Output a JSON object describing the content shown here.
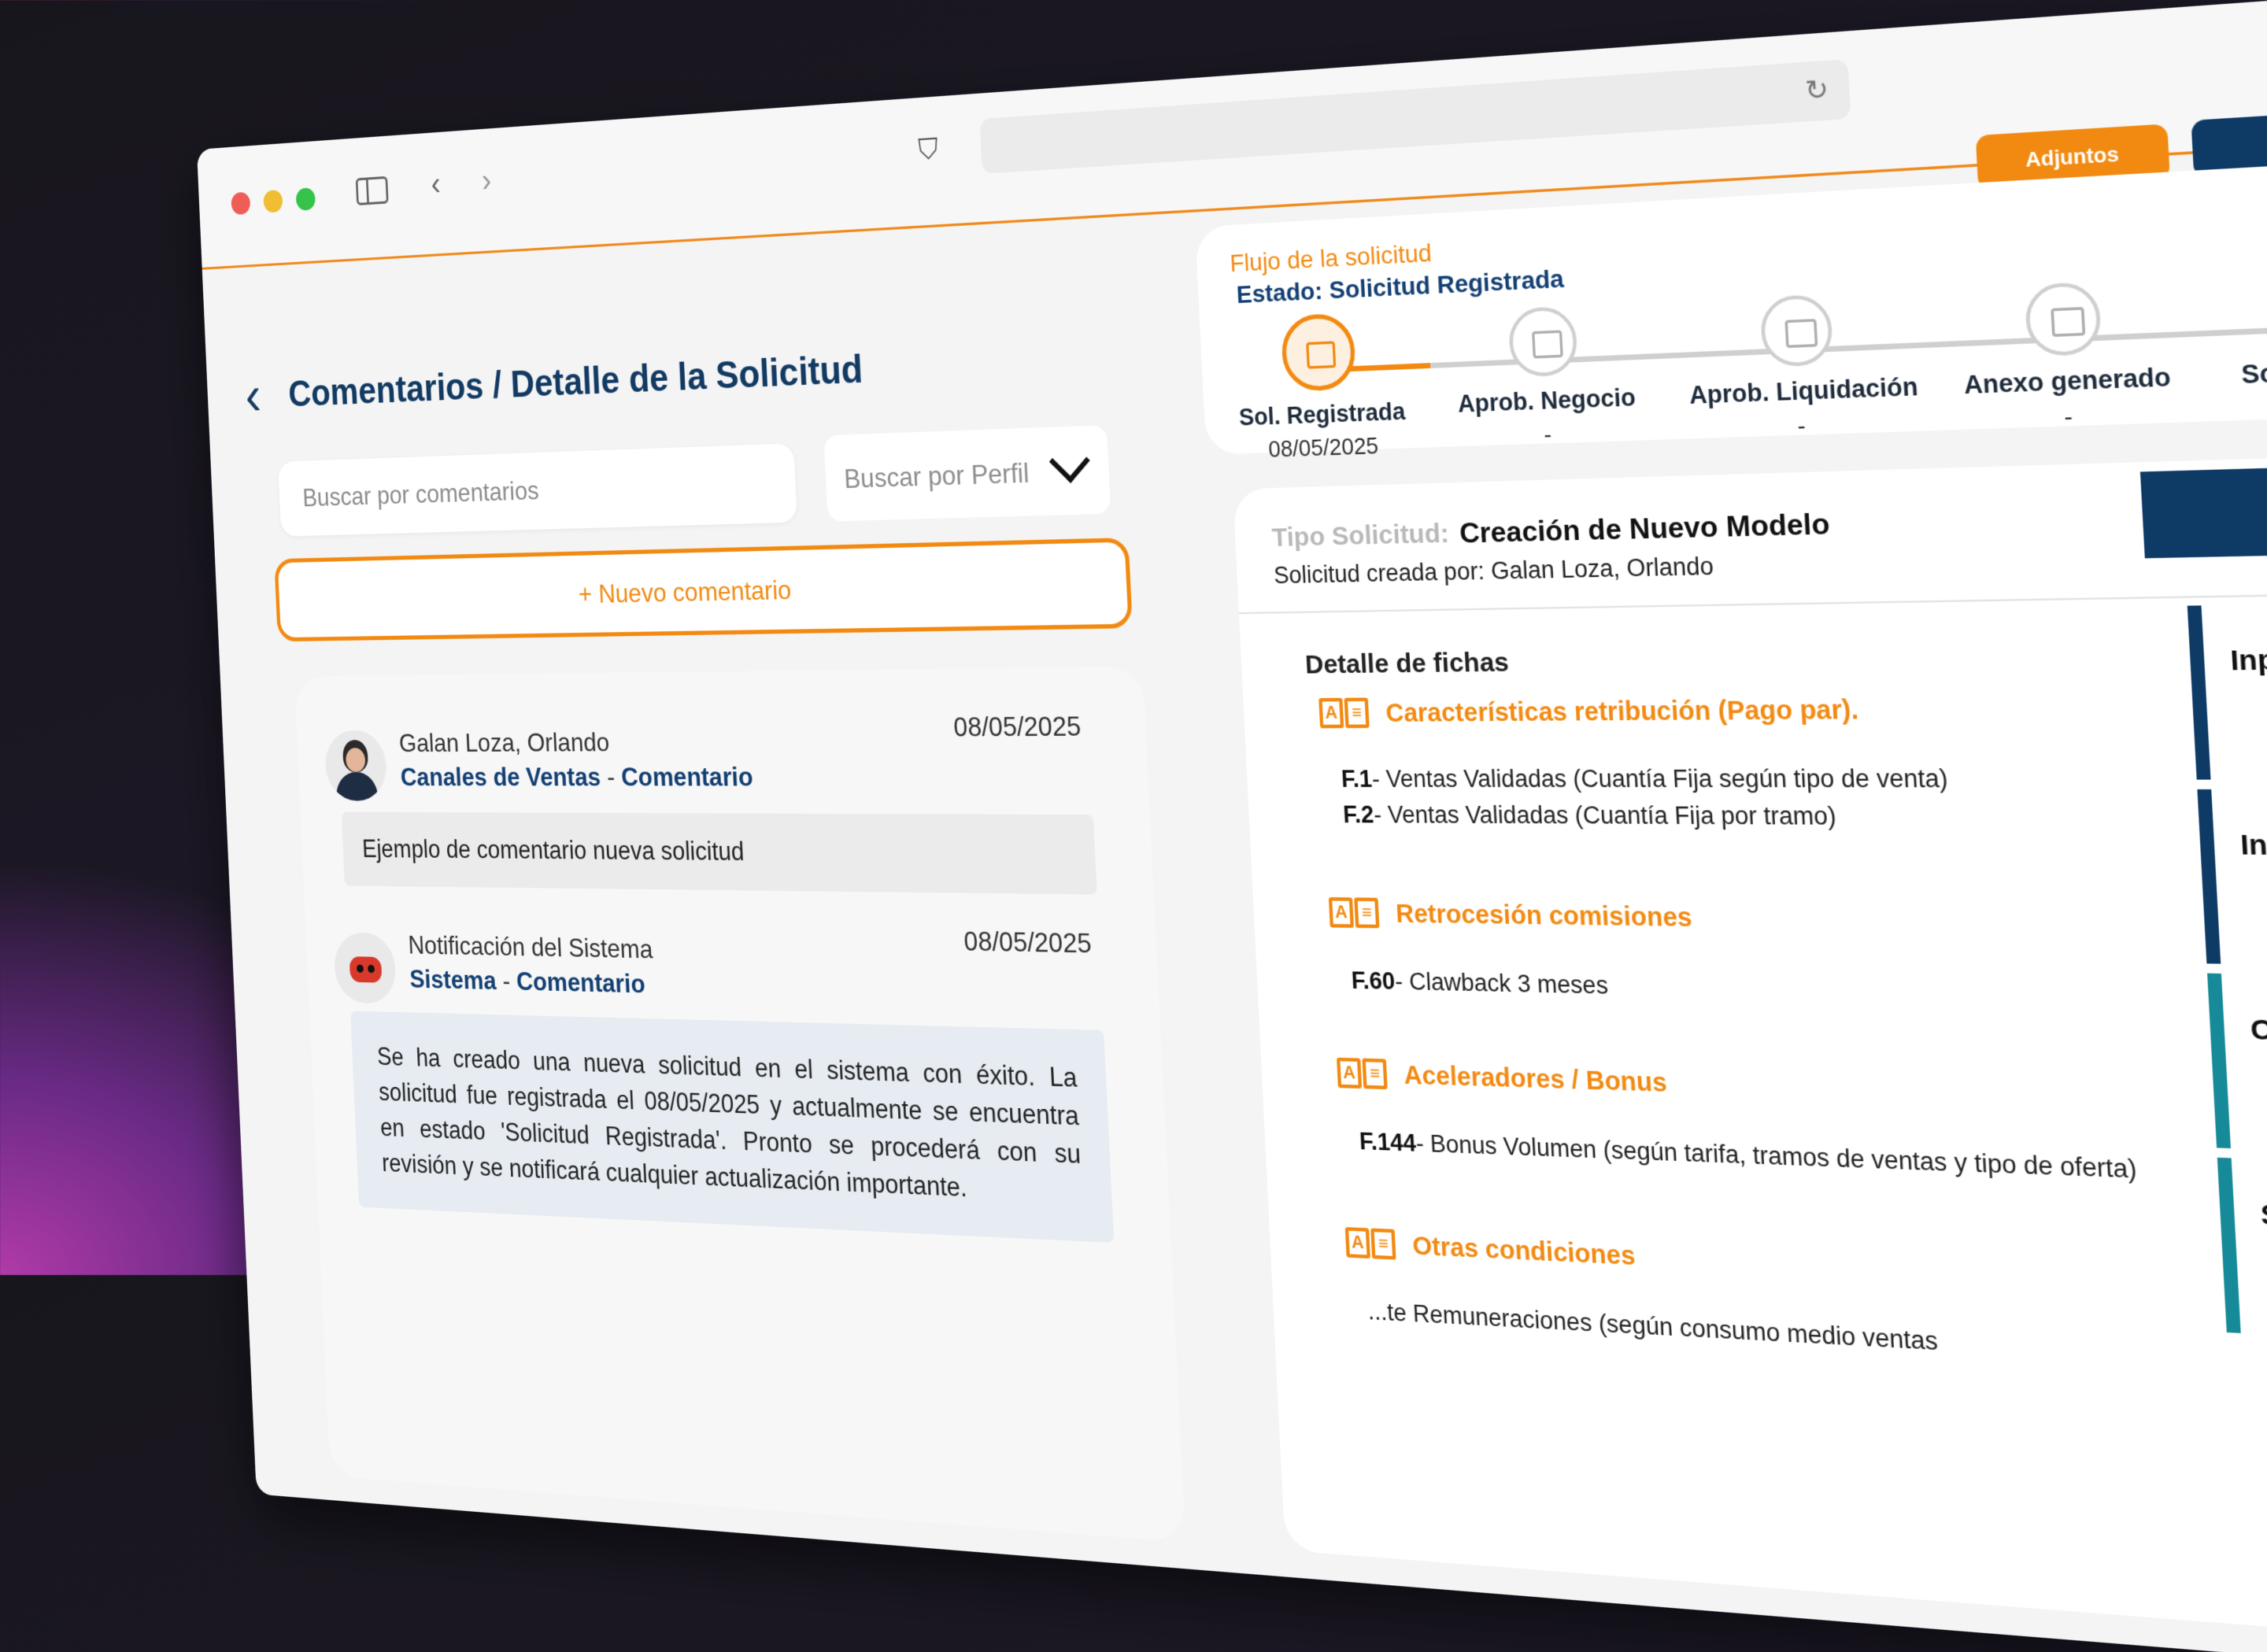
{
  "browser": {
    "buttons": {
      "adjuntos": "Adjuntos"
    }
  },
  "left": {
    "title": "Comentarios / Detalle de la Solicitud",
    "search_placeholder": "Buscar por comentarios",
    "profile_placeholder": "Buscar por Perfil",
    "new_comment": "+ Nuevo comentario",
    "comments": [
      {
        "author": "Galan Loza, Orlando",
        "channel": "Canales de Ventas",
        "sep": " - ",
        "type": "Comentario",
        "date": "08/05/2025",
        "body": "Ejemplo de comentario nueva solicitud"
      },
      {
        "author": "Notificación del Sistema",
        "channel": "Sistema",
        "sep": " - ",
        "type": "Comentario",
        "date": "08/05/2025",
        "body": "Se ha creado una nueva solicitud en el sistema con éxito. La solicitud fue registrada el 08/05/2025 y actualmente se encuentra en estado 'Solicitud Registrada'. Pronto se procederá con su revisión y se notificará cualquier actualización importante."
      }
    ]
  },
  "flow": {
    "title": "Flujo de la solicitud",
    "state": "Estado: Solicitud Registrada",
    "steps": [
      {
        "label": "Sol. Registrada",
        "date": "08/05/2025",
        "active": true
      },
      {
        "label": "Aprob. Negocio",
        "date": "-"
      },
      {
        "label": "Aprob. Liquidación",
        "date": "-"
      },
      {
        "label": "Anexo generado",
        "date": "-"
      },
      {
        "label": "Sol. Concluida",
        "date": "-"
      }
    ]
  },
  "detail": {
    "tipo_label": "Tipo Solicitud:",
    "tipo_value": "Creación de Nuevo Modelo",
    "created_by": "Solicitud creada por: Galan Loza, Orlando",
    "section_title": "Detalle de fichas",
    "sections": [
      {
        "title": "Características retribución (Pago par).",
        "items": [
          {
            "code": "F.1",
            "text": "- Ventas Validadas (Cuantía Fija según tipo de venta)"
          },
          {
            "code": "F.2",
            "text": "- Ventas Validadas (Cuantía Fija por tramo)"
          }
        ]
      },
      {
        "title": "Retrocesión comisiones",
        "items": [
          {
            "code": "F.60",
            "text": "- Clawback 3 meses"
          }
        ]
      },
      {
        "title": "Aceleradores / Bonus",
        "items": [
          {
            "code": "F.144",
            "text": "- Bonus Volumen (según tarifa, tramos de ventas y tipo de oferta)"
          }
        ]
      },
      {
        "title": "Otras condiciones",
        "items": [
          {
            "code": "",
            "text": "...te Remuneraciones (según consumo medio ventas"
          }
        ]
      }
    ],
    "side_header": "In",
    "side_items": [
      {
        "label": "Inputs Externos",
        "color": "#0e3a66"
      },
      {
        "label": "Inputs Sistemas",
        "color": "#0e3a66"
      },
      {
        "label": "Canal",
        "color": "#178a9a"
      },
      {
        "label": "Sub",
        "color": "#178a9a"
      }
    ]
  },
  "colors": {
    "accent": "#f28a12",
    "navy": "#133f73"
  }
}
